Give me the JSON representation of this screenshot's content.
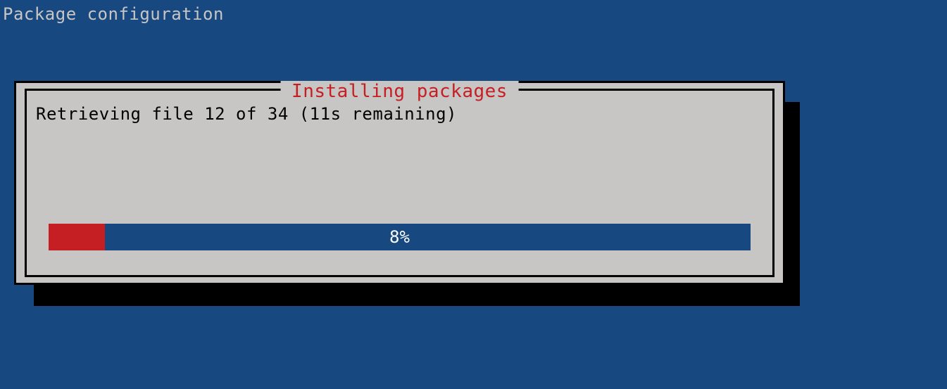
{
  "page_title": "Package configuration",
  "dialog": {
    "title": "Installing packages",
    "status_text": "Retrieving file 12 of 34 (11s remaining)",
    "progress": {
      "percent": 8,
      "label": "8%"
    }
  },
  "colors": {
    "background": "#174880",
    "dialog_bg": "#c8c5c5",
    "title_red": "#c61f23",
    "progress_fill": "#c61f23",
    "progress_bg": "#174880"
  }
}
